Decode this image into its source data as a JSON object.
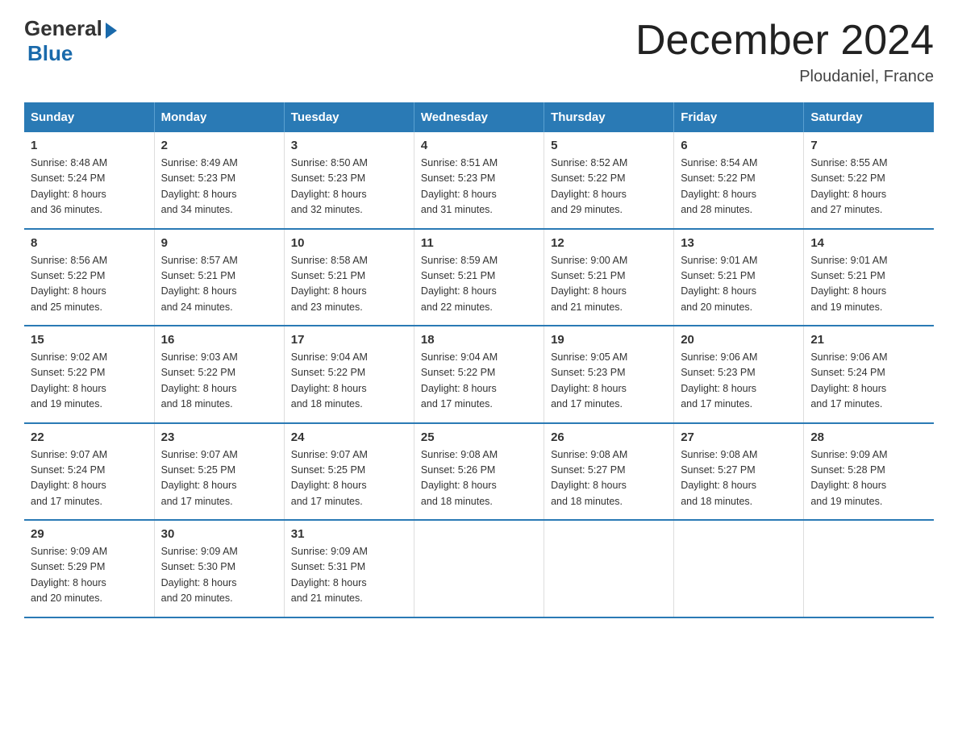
{
  "logo": {
    "general": "General",
    "blue": "Blue"
  },
  "title": "December 2024",
  "subtitle": "Ploudaniel, France",
  "days_header": [
    "Sunday",
    "Monday",
    "Tuesday",
    "Wednesday",
    "Thursday",
    "Friday",
    "Saturday"
  ],
  "weeks": [
    [
      {
        "day": "1",
        "info": "Sunrise: 8:48 AM\nSunset: 5:24 PM\nDaylight: 8 hours\nand 36 minutes."
      },
      {
        "day": "2",
        "info": "Sunrise: 8:49 AM\nSunset: 5:23 PM\nDaylight: 8 hours\nand 34 minutes."
      },
      {
        "day": "3",
        "info": "Sunrise: 8:50 AM\nSunset: 5:23 PM\nDaylight: 8 hours\nand 32 minutes."
      },
      {
        "day": "4",
        "info": "Sunrise: 8:51 AM\nSunset: 5:23 PM\nDaylight: 8 hours\nand 31 minutes."
      },
      {
        "day": "5",
        "info": "Sunrise: 8:52 AM\nSunset: 5:22 PM\nDaylight: 8 hours\nand 29 minutes."
      },
      {
        "day": "6",
        "info": "Sunrise: 8:54 AM\nSunset: 5:22 PM\nDaylight: 8 hours\nand 28 minutes."
      },
      {
        "day": "7",
        "info": "Sunrise: 8:55 AM\nSunset: 5:22 PM\nDaylight: 8 hours\nand 27 minutes."
      }
    ],
    [
      {
        "day": "8",
        "info": "Sunrise: 8:56 AM\nSunset: 5:22 PM\nDaylight: 8 hours\nand 25 minutes."
      },
      {
        "day": "9",
        "info": "Sunrise: 8:57 AM\nSunset: 5:21 PM\nDaylight: 8 hours\nand 24 minutes."
      },
      {
        "day": "10",
        "info": "Sunrise: 8:58 AM\nSunset: 5:21 PM\nDaylight: 8 hours\nand 23 minutes."
      },
      {
        "day": "11",
        "info": "Sunrise: 8:59 AM\nSunset: 5:21 PM\nDaylight: 8 hours\nand 22 minutes."
      },
      {
        "day": "12",
        "info": "Sunrise: 9:00 AM\nSunset: 5:21 PM\nDaylight: 8 hours\nand 21 minutes."
      },
      {
        "day": "13",
        "info": "Sunrise: 9:01 AM\nSunset: 5:21 PM\nDaylight: 8 hours\nand 20 minutes."
      },
      {
        "day": "14",
        "info": "Sunrise: 9:01 AM\nSunset: 5:21 PM\nDaylight: 8 hours\nand 19 minutes."
      }
    ],
    [
      {
        "day": "15",
        "info": "Sunrise: 9:02 AM\nSunset: 5:22 PM\nDaylight: 8 hours\nand 19 minutes."
      },
      {
        "day": "16",
        "info": "Sunrise: 9:03 AM\nSunset: 5:22 PM\nDaylight: 8 hours\nand 18 minutes."
      },
      {
        "day": "17",
        "info": "Sunrise: 9:04 AM\nSunset: 5:22 PM\nDaylight: 8 hours\nand 18 minutes."
      },
      {
        "day": "18",
        "info": "Sunrise: 9:04 AM\nSunset: 5:22 PM\nDaylight: 8 hours\nand 17 minutes."
      },
      {
        "day": "19",
        "info": "Sunrise: 9:05 AM\nSunset: 5:23 PM\nDaylight: 8 hours\nand 17 minutes."
      },
      {
        "day": "20",
        "info": "Sunrise: 9:06 AM\nSunset: 5:23 PM\nDaylight: 8 hours\nand 17 minutes."
      },
      {
        "day": "21",
        "info": "Sunrise: 9:06 AM\nSunset: 5:24 PM\nDaylight: 8 hours\nand 17 minutes."
      }
    ],
    [
      {
        "day": "22",
        "info": "Sunrise: 9:07 AM\nSunset: 5:24 PM\nDaylight: 8 hours\nand 17 minutes."
      },
      {
        "day": "23",
        "info": "Sunrise: 9:07 AM\nSunset: 5:25 PM\nDaylight: 8 hours\nand 17 minutes."
      },
      {
        "day": "24",
        "info": "Sunrise: 9:07 AM\nSunset: 5:25 PM\nDaylight: 8 hours\nand 17 minutes."
      },
      {
        "day": "25",
        "info": "Sunrise: 9:08 AM\nSunset: 5:26 PM\nDaylight: 8 hours\nand 18 minutes."
      },
      {
        "day": "26",
        "info": "Sunrise: 9:08 AM\nSunset: 5:27 PM\nDaylight: 8 hours\nand 18 minutes."
      },
      {
        "day": "27",
        "info": "Sunrise: 9:08 AM\nSunset: 5:27 PM\nDaylight: 8 hours\nand 18 minutes."
      },
      {
        "day": "28",
        "info": "Sunrise: 9:09 AM\nSunset: 5:28 PM\nDaylight: 8 hours\nand 19 minutes."
      }
    ],
    [
      {
        "day": "29",
        "info": "Sunrise: 9:09 AM\nSunset: 5:29 PM\nDaylight: 8 hours\nand 20 minutes."
      },
      {
        "day": "30",
        "info": "Sunrise: 9:09 AM\nSunset: 5:30 PM\nDaylight: 8 hours\nand 20 minutes."
      },
      {
        "day": "31",
        "info": "Sunrise: 9:09 AM\nSunset: 5:31 PM\nDaylight: 8 hours\nand 21 minutes."
      },
      {
        "day": "",
        "info": ""
      },
      {
        "day": "",
        "info": ""
      },
      {
        "day": "",
        "info": ""
      },
      {
        "day": "",
        "info": ""
      }
    ]
  ]
}
